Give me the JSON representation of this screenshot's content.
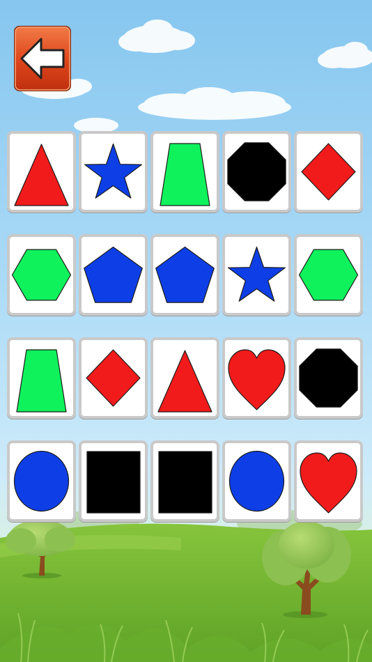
{
  "header": {
    "back_button": {
      "icon": "left-arrow-icon",
      "color": "#e0481d"
    }
  },
  "palette": {
    "red": "#f21b1b",
    "blue": "#0e3fe6",
    "green": "#0ff25c",
    "black": "#000000"
  },
  "board": {
    "columns": 5,
    "rows": [
      [
        {
          "shape": "triangle",
          "color": "red"
        },
        {
          "shape": "star",
          "color": "blue"
        },
        {
          "shape": "trapezoid",
          "color": "green"
        },
        {
          "shape": "octagon",
          "color": "black"
        },
        {
          "shape": "diamond",
          "color": "red"
        }
      ],
      [
        {
          "shape": "hexagon",
          "color": "green"
        },
        {
          "shape": "pentagon",
          "color": "blue"
        },
        {
          "shape": "pentagon",
          "color": "blue"
        },
        {
          "shape": "star",
          "color": "blue"
        },
        {
          "shape": "hexagon",
          "color": "green"
        }
      ],
      [
        {
          "shape": "trapezoid",
          "color": "green"
        },
        {
          "shape": "diamond",
          "color": "red"
        },
        {
          "shape": "triangle",
          "color": "red"
        },
        {
          "shape": "heart",
          "color": "red"
        },
        {
          "shape": "octagon",
          "color": "black"
        }
      ],
      [
        {
          "shape": "circle",
          "color": "blue"
        },
        {
          "shape": "square",
          "color": "black"
        },
        {
          "shape": "square",
          "color": "black"
        },
        {
          "shape": "circle",
          "color": "blue"
        },
        {
          "shape": "heart",
          "color": "red"
        }
      ]
    ]
  }
}
